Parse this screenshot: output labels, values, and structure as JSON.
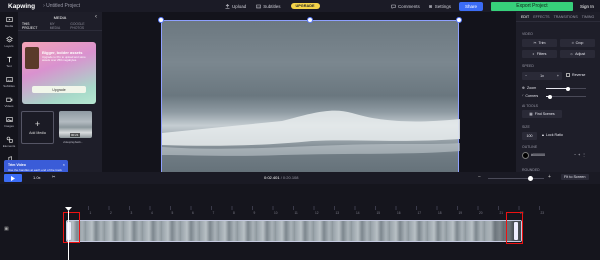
{
  "topbar": {
    "logo": "Kapwing",
    "project": "› Untitled Project",
    "upload": "Upload",
    "subtitles": "Subtitles",
    "upgrade": "UPGRADE",
    "comments": "Comments",
    "settings": "Settings",
    "share": "Share",
    "export": "Export Project",
    "signin": "Sign In"
  },
  "rail": {
    "items": [
      "Media",
      "Layers",
      "Text",
      "Subtitles",
      "Videos",
      "Images",
      "Elements",
      "Audio",
      "Transitions"
    ]
  },
  "media": {
    "title": "MEDIA",
    "tabs": [
      "THIS PROJECT",
      "MY MEDIA",
      "GOOGLE PHOTOS"
    ],
    "promo": {
      "title": "Bigger, bolder assets",
      "body": "Upgrade to Pro to upload and store assets over 250 megabytes.",
      "button": "Upgrade"
    },
    "add_media": "Add Media",
    "thumb_duration": "00:21",
    "thumb_name": "videoplayback..."
  },
  "tooltip": {
    "title": "Trim Video",
    "body": "Use the handles at each end of the track to trim the video. Drag the track to change when it starts."
  },
  "right_panel": {
    "tabs": [
      "EDIT",
      "EFFECTS",
      "TRANSITIONS",
      "TIMING"
    ],
    "video_label": "VIDEO",
    "trim": "Trim",
    "crop": "Crop",
    "filters": "Filters",
    "adjust": "Adjust",
    "speed_label": "SPEED",
    "speed_value": "1x",
    "reverse": "Reverse",
    "zoom": "Zoom",
    "corners": "Corners",
    "ai_tools": "AI TOOLS",
    "find_scenes": "Find Scenes",
    "size_label": "SIZE",
    "size_value": "100",
    "lock_ratio": "Lock Ratio",
    "outline_label": "OUTLINE",
    "outline_color": "#000000",
    "rounded_label": "ROUNDED",
    "zoom_level": 0.55,
    "corners_level": 0.1
  },
  "timeline": {
    "speed": "1.0x",
    "current_time": "0:02.401",
    "total_time": "0:20.108",
    "fit": "Fit to Screen",
    "ticks": [
      "1",
      "2",
      "3",
      "4",
      "5",
      "6",
      "7",
      "8",
      "9",
      "10",
      "11",
      "12",
      "13",
      "14",
      "15",
      "16",
      "17",
      "18",
      "19",
      "20",
      "21",
      "22",
      "23"
    ]
  },
  "colors": {
    "accent": "#3b6cf5",
    "export": "#37d07b",
    "upgrade": "#f5d44a",
    "highlight": "#e11111"
  }
}
